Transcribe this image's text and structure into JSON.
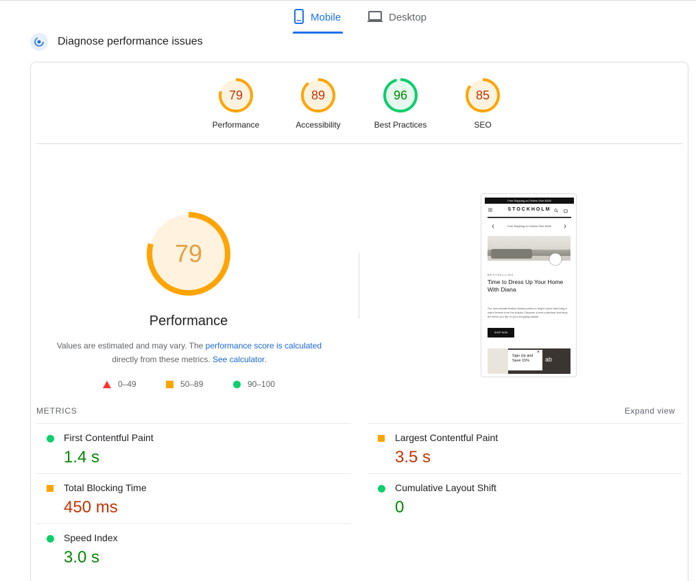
{
  "tabs": [
    {
      "label": "Mobile",
      "active": true
    },
    {
      "label": "Desktop",
      "active": false
    }
  ],
  "section_title": "Diagnose performance issues",
  "categories": [
    {
      "score": "79",
      "label": "Performance",
      "fraction": 0.79,
      "color": "#ffa400"
    },
    {
      "score": "89",
      "label": "Accessibility",
      "fraction": 0.89,
      "color": "#ffa400"
    },
    {
      "score": "96",
      "label": "Best Practices",
      "fraction": 0.96,
      "color": "#0cce6b"
    },
    {
      "score": "85",
      "label": "SEO",
      "fraction": 0.85,
      "color": "#ffa400"
    }
  ],
  "performance": {
    "score": "79",
    "fraction": 0.79,
    "title": "Performance",
    "note_prefix": "Values are estimated and may vary. The ",
    "note_link1": "performance score is calculated",
    "note_middle": " directly from these metrics. ",
    "note_link2": "See calculator",
    "note_suffix": "."
  },
  "legend": [
    {
      "range": "0–49",
      "shape": "triangle",
      "color": "#ff3333"
    },
    {
      "range": "50–89",
      "shape": "square",
      "color": "#ffa400"
    },
    {
      "range": "90–100",
      "shape": "circle",
      "color": "#0cce6b"
    }
  ],
  "screenshot": {
    "banner": "Free Shipping on Orders Over $150",
    "brand": "STOCKHOLM",
    "shipping": "Free Shipping on Orders Over $150",
    "kicker": "BESTSELLING",
    "headline": "Time to Dress Up Your Home With Diana",
    "body": "Our new arrivals feature flowery prints in bright colors that bring a warm breeze from the tropics. Discover a new collection and shop the items you like in your shopping basket.",
    "button": "SHOP NOW",
    "popup": "Sign Up and Save 15%",
    "popup_close": "×",
    "promo_text": "ab"
  },
  "metrics_header": {
    "title": "METRICS",
    "expand": "Expand view"
  },
  "metrics": [
    {
      "name": "First Contentful Paint",
      "value": "1.4 s",
      "status": "good"
    },
    {
      "name": "Largest Contentful Paint",
      "value": "3.5 s",
      "status": "average"
    },
    {
      "name": "Total Blocking Time",
      "value": "450 ms",
      "status": "average"
    },
    {
      "name": "Cumulative Layout Shift",
      "value": "0",
      "status": "good"
    },
    {
      "name": "Speed Index",
      "value": "3.0 s",
      "status": "good"
    }
  ]
}
